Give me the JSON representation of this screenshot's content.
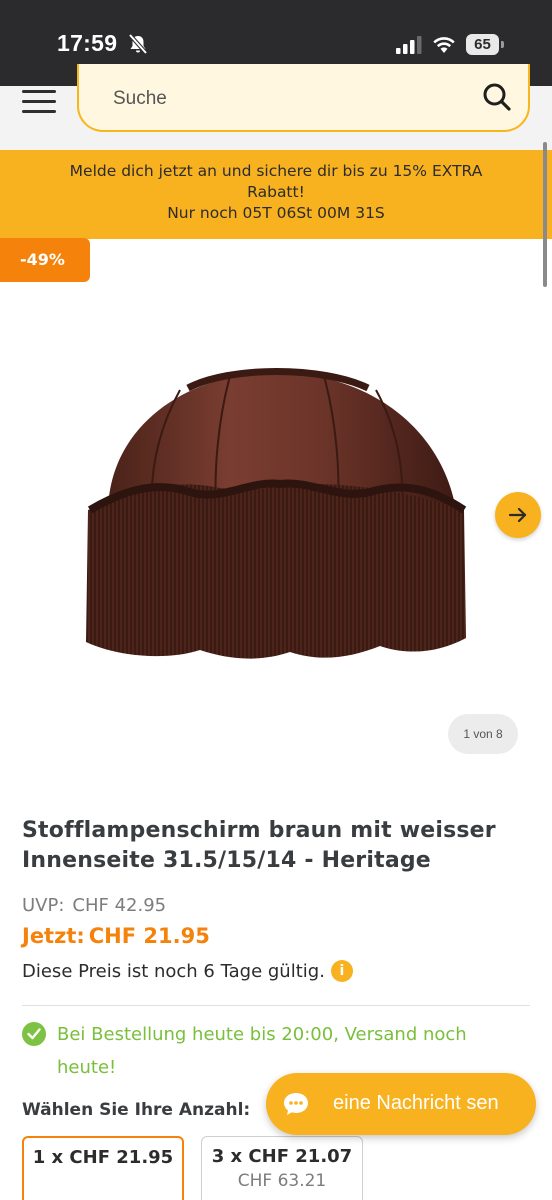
{
  "status_bar": {
    "time": "17:59",
    "battery": "65",
    "icons": [
      "bell-slash-icon",
      "signal-icon",
      "wifi-icon",
      "battery-icon"
    ]
  },
  "header": {
    "search_placeholder": "Suche",
    "icons": [
      "menu-icon",
      "search-icon"
    ]
  },
  "promo": {
    "line1": "Melde dich jetzt an und sichere dir bis zu 15% EXTRA",
    "line2": "Rabatt!",
    "line3": "Nur noch 05T 06St 00M 31S"
  },
  "product": {
    "discount_badge": "-49%",
    "image_counter": "1 von 8",
    "title": "Stofflampenschirm braun mit weisser Innenseite 31.5/15/14 - Heritage",
    "uvp_label": "UVP:",
    "uvp_price": "CHF 42.95",
    "price_label": "Jetzt:",
    "price": "CHF 21.95",
    "validity": "Diese Preis ist noch 6 Tage gültig.",
    "info_icon_glyph": "i",
    "shipping": "Bei Bestellung heute bis 20:00, Versand noch heute!",
    "quantity_label": "Wählen Sie Ihre Anzahl:",
    "options": [
      {
        "main": "1 x CHF 21.95",
        "sub": ""
      },
      {
        "main": "3 x CHF 21.07",
        "sub": "CHF 63.21"
      }
    ]
  },
  "chat": {
    "label": "eine Nachricht sen"
  },
  "colors": {
    "accent_yellow": "#f8b220",
    "accent_orange": "#f5820a",
    "success_green": "#79bf3c",
    "status_bar": "#2b2b2d"
  }
}
